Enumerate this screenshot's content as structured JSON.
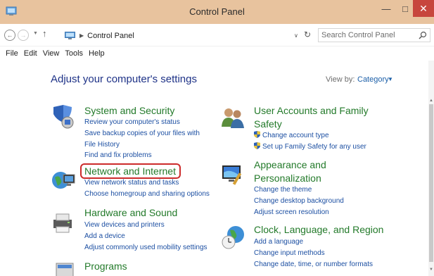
{
  "window": {
    "title": "Control Panel",
    "minimize_glyph": "—",
    "maximize_glyph": "□",
    "close_glyph": "✕"
  },
  "address": {
    "path": [
      "Control Panel"
    ],
    "search_placeholder": "Search Control Panel"
  },
  "menu": [
    "File",
    "Edit",
    "View",
    "Tools",
    "Help"
  ],
  "content": {
    "heading": "Adjust your computer's settings",
    "view_by_label": "View by:",
    "view_by_value": "Category"
  },
  "categories": [
    {
      "title": "System and Security",
      "icon": "system-security-icon",
      "links": [
        "Review your computer's status",
        "Save backup copies of your files with File History",
        "Find and fix problems"
      ]
    },
    {
      "title": "Network and Internet",
      "icon": "network-internet-icon",
      "links": [
        "View network status and tasks",
        "Choose homegroup and sharing options"
      ]
    },
    {
      "title": "Hardware and Sound",
      "icon": "hardware-sound-icon",
      "links": [
        "View devices and printers",
        "Add a device",
        "Adjust commonly used mobility settings"
      ]
    },
    {
      "title": "Programs",
      "icon": "programs-icon",
      "links": []
    },
    {
      "title": "User Accounts and Family Safety",
      "icon": "user-accounts-icon",
      "links": [
        "Change account type",
        "Set up Family Safety for any user"
      ]
    },
    {
      "title": "Appearance and Personalization",
      "icon": "appearance-icon",
      "links": [
        "Change the theme",
        "Change desktop background",
        "Adjust screen resolution"
      ]
    },
    {
      "title": "Clock, Language, and Region",
      "icon": "clock-language-icon",
      "links": [
        "Add a language",
        "Change input methods",
        "Change date, time, or number formats"
      ]
    }
  ],
  "colors": {
    "titlebar": "#e8c39e",
    "close_button": "#c7463d",
    "category_title": "#237a2a",
    "link": "#1c4fa2",
    "heading": "#1e3287",
    "highlight_outline": "#cc2b2b"
  }
}
